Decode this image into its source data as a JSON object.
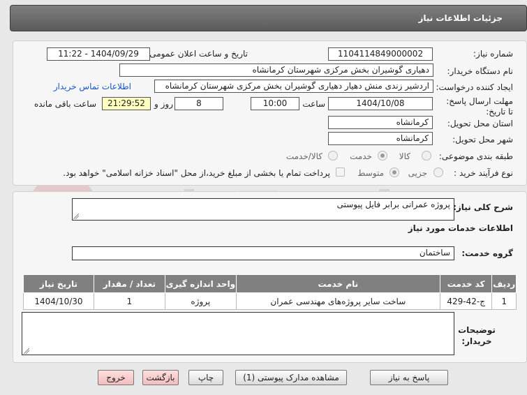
{
  "title": "جزئیات اطلاعات نیاز",
  "need_number": {
    "label": "شماره نیاز:",
    "value": "1104114849000002"
  },
  "announce_date": {
    "label": "تاریخ و ساعت اعلان عمومی:",
    "value": "1404/09/29 - 11:22"
  },
  "buyer_org": {
    "label": "نام دستگاه خریدار:",
    "value": "دهیاری گوشیران بخش مرکزی شهرستان کرمانشاه"
  },
  "requester": {
    "label": "ایجاد کننده درخواست:",
    "value": "اردشیر زندی منش دهیار دهیاری گوشیران بخش مرکزی شهرستان کرمانشاه",
    "contact_link": "اطلاعات تماس خریدار"
  },
  "deadline": {
    "label": "مهلت ارسال پاسخ: تا تاریخ:",
    "date": "1404/10/08",
    "time_label": "ساعت",
    "time": "10:00",
    "days": "8",
    "days_label": "روز و",
    "remaining": "21:29:52",
    "remaining_label": "ساعت باقی مانده"
  },
  "province": {
    "label": "استان محل تحویل:",
    "value": "کرمانشاه"
  },
  "city": {
    "label": "شهر محل تحویل:",
    "value": "کرمانشاه"
  },
  "category": {
    "label": "طبقه بندی موضوعی:",
    "options": [
      "کالا",
      "خدمت",
      "کالا/خدمت"
    ],
    "selected": "خدمت"
  },
  "process": {
    "label": "نوع فرآیند خرید :",
    "options": [
      "جزیی",
      "متوسط"
    ],
    "selected": "متوسط",
    "note": "پرداخت تمام یا بخشی از مبلغ خرید،از محل \"اسناد خزانه اسلامی\" خواهد بود."
  },
  "description": {
    "label": "شرح کلی نیاز:",
    "value": "پروژه عمرانی برابر فایل پیوستی"
  },
  "services_heading": "اطلاعات خدمات مورد نیاز",
  "service_group": {
    "label": "گروه خدمت:",
    "value": "ساختمان"
  },
  "table": {
    "headers": [
      "ردیف",
      "کد خدمت",
      "نام خدمت",
      "واحد اندازه گیری",
      "تعداد / مقدار",
      "تاریخ نیاز"
    ],
    "rows": [
      [
        "1",
        "ج-42-429",
        "ساخت سایر پروژه‌های مهندسی عمران",
        "پروژه",
        "1",
        "1404/10/30"
      ]
    ]
  },
  "buyer_notes": {
    "label": "توضیحات خریدار:",
    "value": ""
  },
  "buttons": {
    "reply": "پاسخ به نیاز",
    "attachments": "مشاهده مدارک پیوستی (1)",
    "print": "چاپ",
    "back": "بازگشت",
    "exit": "خروج"
  },
  "watermark": "AriaTender.neT"
}
